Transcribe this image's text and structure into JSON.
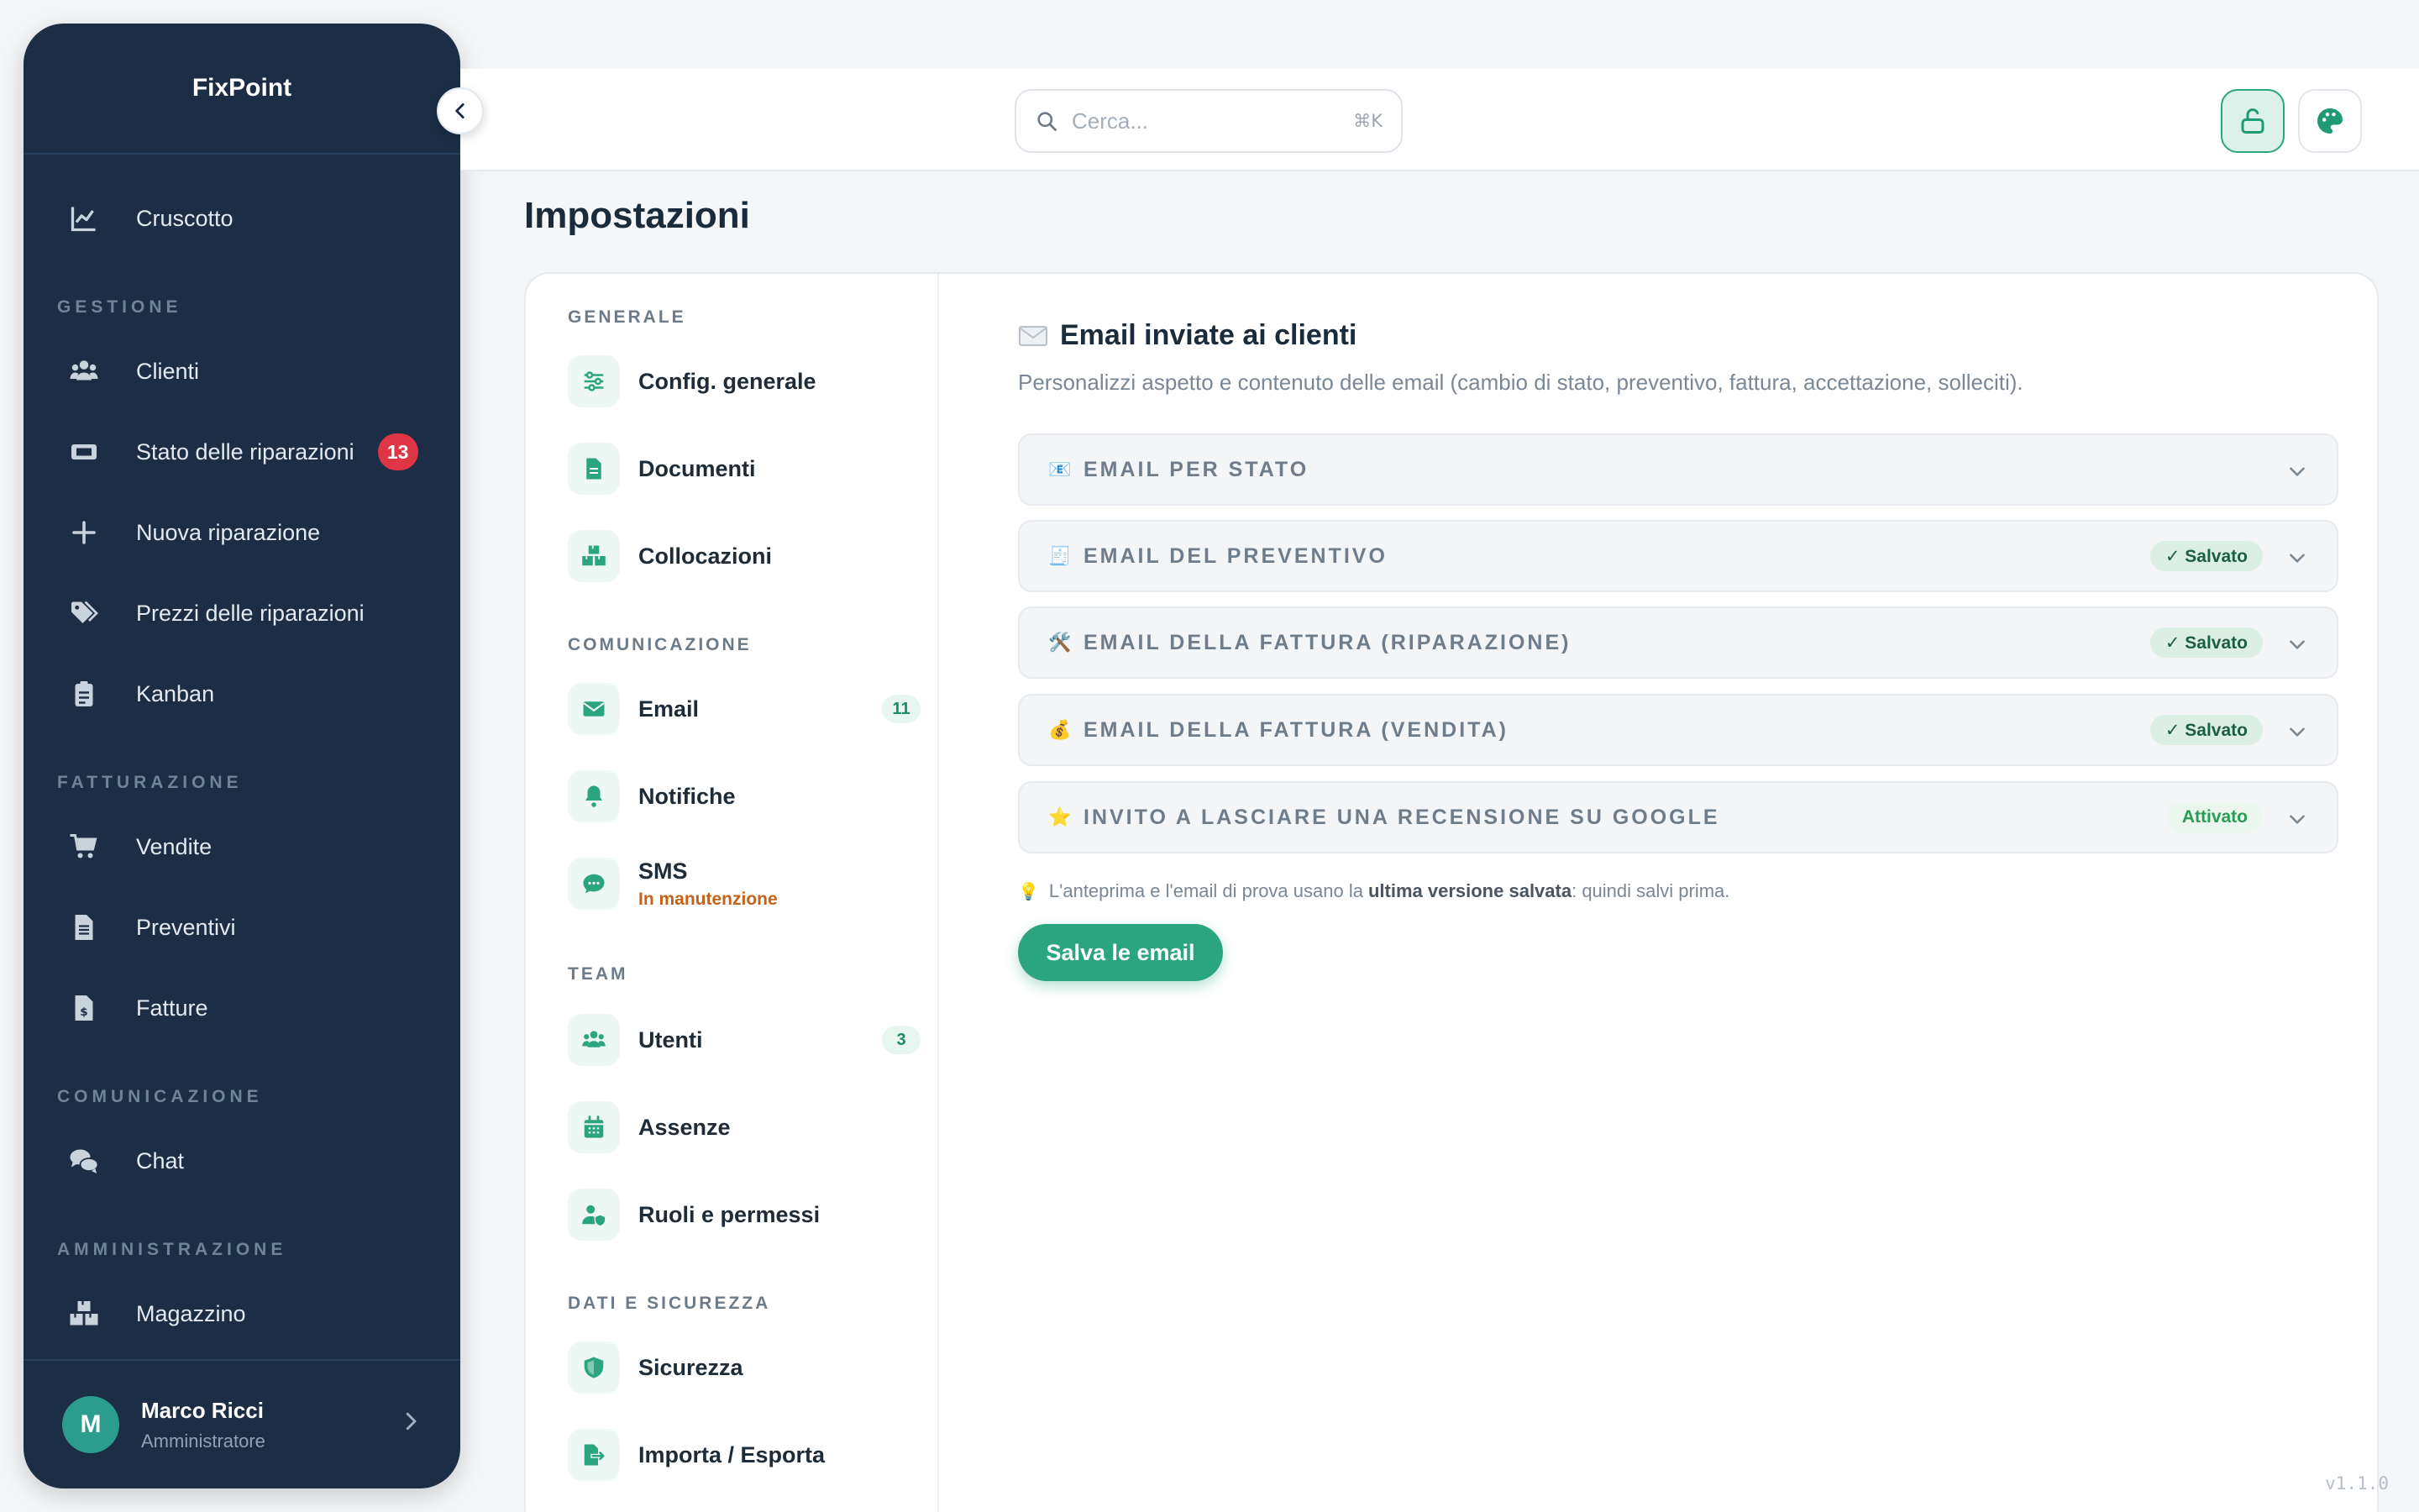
{
  "app": {
    "name": "FixPoint",
    "version": "v1.1.0"
  },
  "sidebar": {
    "dashboard": "Cruscotto",
    "sections": {
      "gestione": "GESTIONE",
      "fatturazione": "FATTURAZIONE",
      "comunicazione": "COMUNICAZIONE",
      "amministrazione": "AMMINISTRAZIONE"
    },
    "items": {
      "clienti": "Clienti",
      "stato": "Stato delle riparazioni",
      "stato_badge": "13",
      "nuova": "Nuova riparazione",
      "prezzi": "Prezzi delle riparazioni",
      "kanban": "Kanban",
      "vendite": "Vendite",
      "preventivi": "Preventivi",
      "fatture": "Fatture",
      "chat": "Chat",
      "magazzino": "Magazzino"
    },
    "user": {
      "initial": "M",
      "name": "Marco Ricci",
      "role": "Amministratore"
    }
  },
  "topbar": {
    "search_placeholder": "Cerca...",
    "search_shortcut": "⌘K"
  },
  "page": {
    "title": "Impostazioni"
  },
  "settings_nav": {
    "sections": {
      "generale": "GENERALE",
      "comunicazione": "COMUNICAZIONE",
      "team": "TEAM",
      "dati": "DATI E SICUREZZA"
    },
    "items": {
      "config": "Config. generale",
      "documenti": "Documenti",
      "collocazioni": "Collocazioni",
      "email": "Email",
      "email_count": "11",
      "notifiche": "Notifiche",
      "sms": "SMS",
      "sms_status": "In manutenzione",
      "utenti": "Utenti",
      "utenti_count": "3",
      "assenze": "Assenze",
      "ruoli": "Ruoli e permessi",
      "sicurezza": "Sicurezza",
      "importa": "Importa / Esporta"
    }
  },
  "content": {
    "icon": "✉️",
    "title": "Email inviate ai clienti",
    "description": "Personalizzi aspetto e contenuto delle email (cambio di stato, preventivo, fattura, accettazione, solleciti).",
    "accordions": [
      {
        "emoji": "📧",
        "label": "EMAIL PER STATO",
        "pill": ""
      },
      {
        "emoji": "🧾",
        "label": "EMAIL DEL PREVENTIVO",
        "pill": "✓ Salvato"
      },
      {
        "emoji": "🛠️",
        "label": "EMAIL DELLA FATTURA (RIPARAZIONE)",
        "pill": "✓ Salvato"
      },
      {
        "emoji": "💰",
        "label": "EMAIL DELLA FATTURA (VENDITA)",
        "pill": "✓ Salvato"
      },
      {
        "emoji": "⭐",
        "label": "INVITO A LASCIARE UNA RECENSIONE SU GOOGLE",
        "pill": "Attivato"
      }
    ],
    "hint": {
      "icon": "💡",
      "before": "L'anteprima e l'email di prova usano la",
      "bold": "ultima versione salvata",
      "after": ": quindi salvi prima."
    },
    "save_label": "Salva le email"
  },
  "colors": {
    "accent": "#2ba57f",
    "sidebar_bg": "#1b2e45",
    "badge": "#e03545"
  }
}
